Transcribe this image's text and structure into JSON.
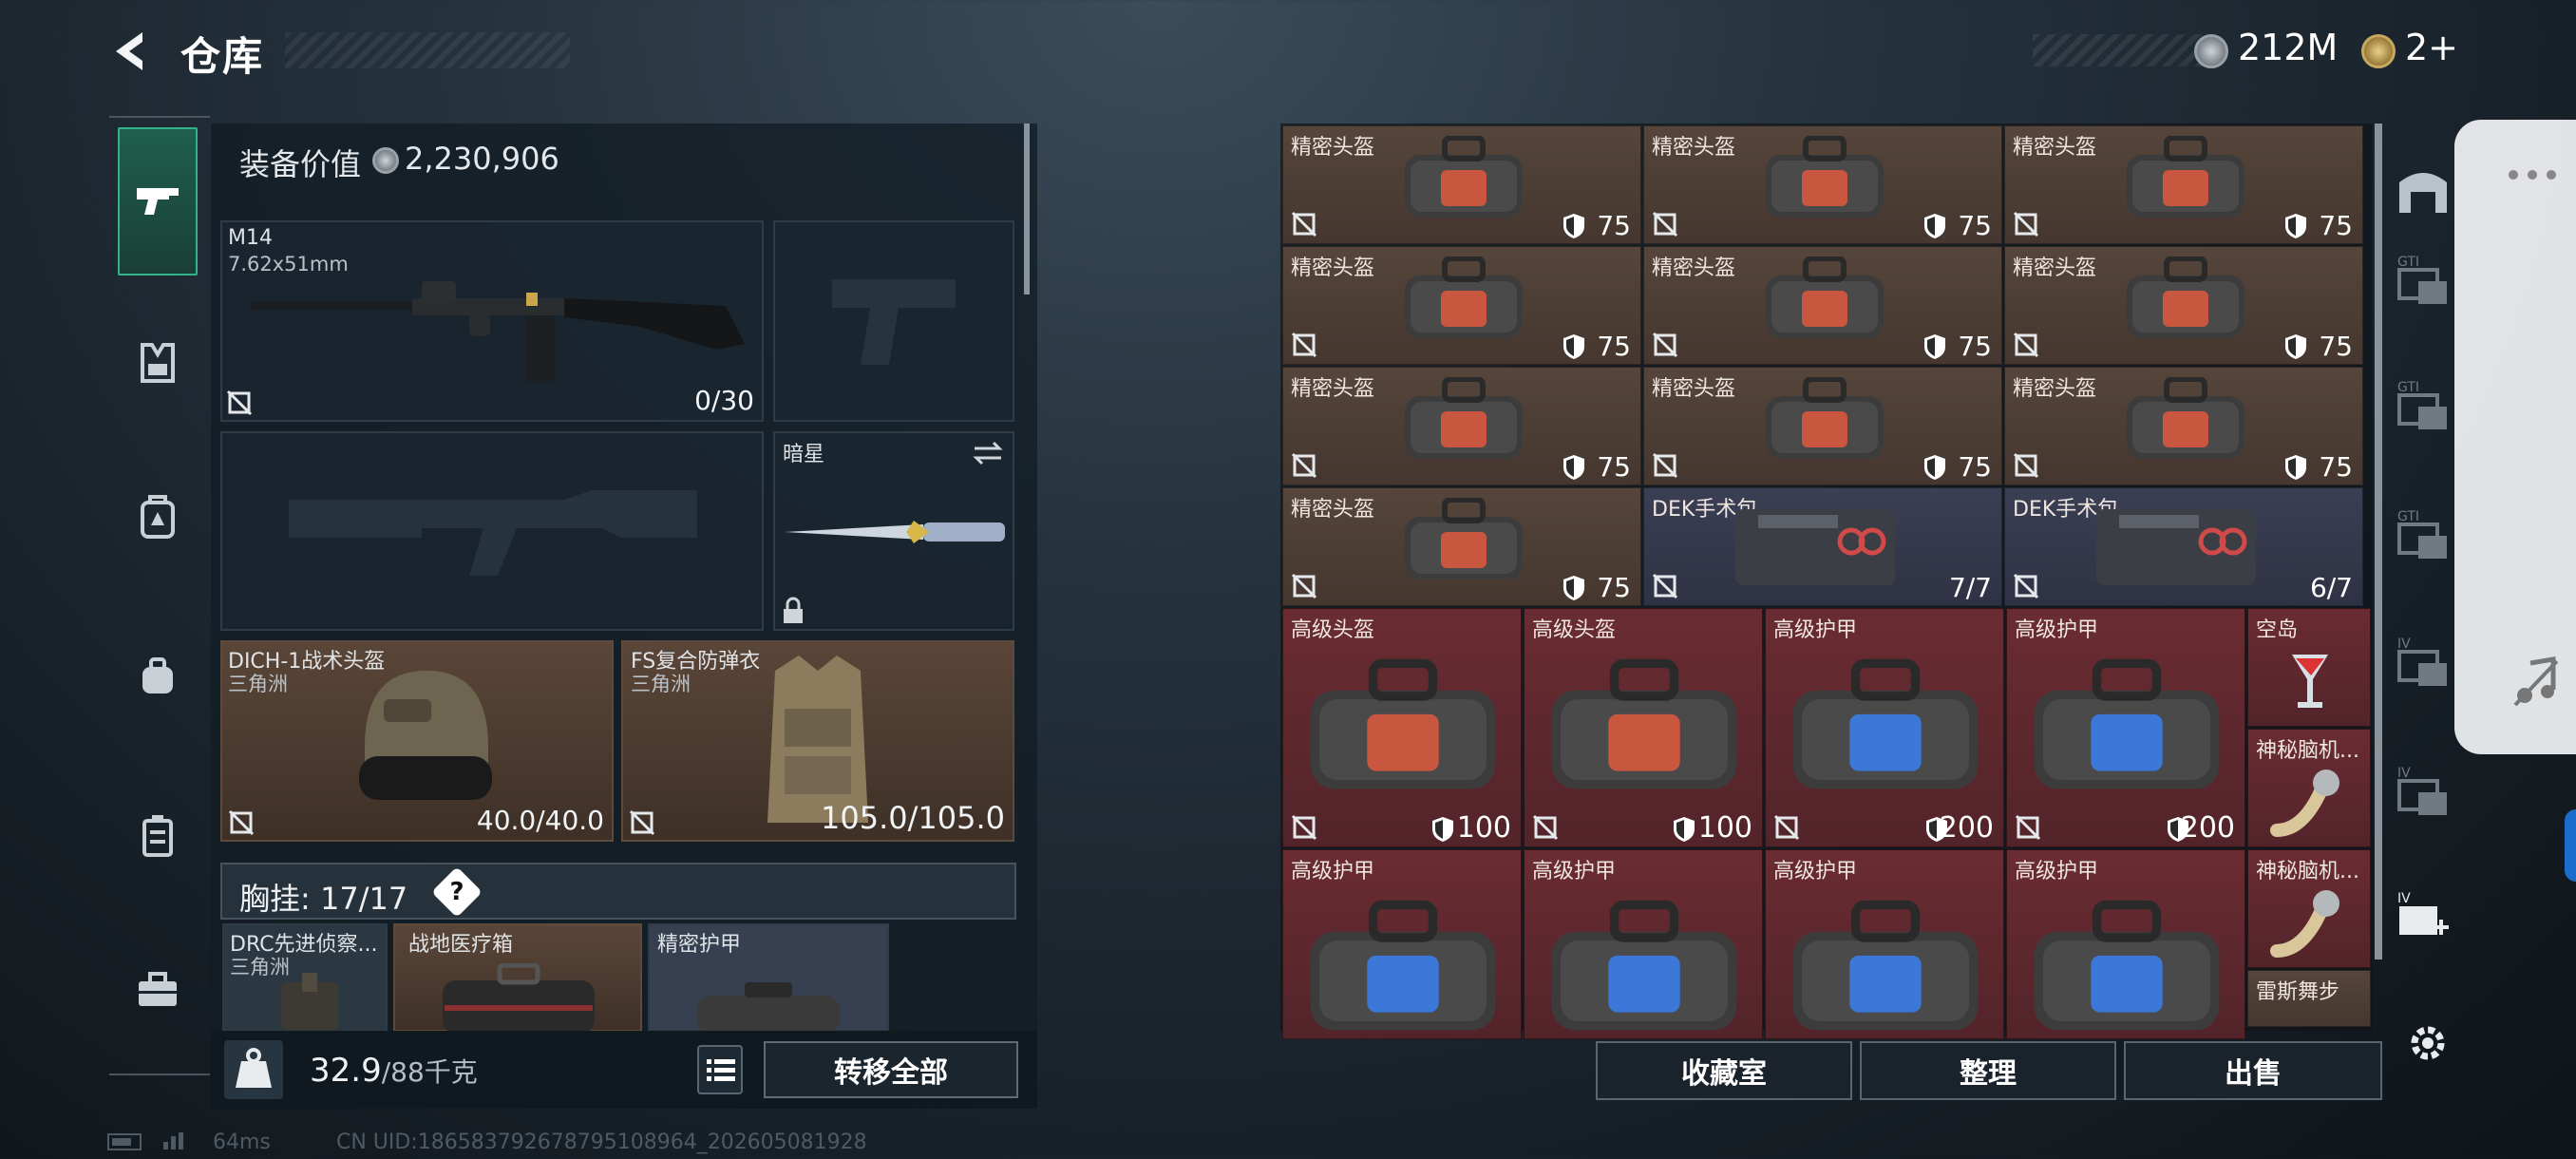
{
  "header": {
    "title": "仓库",
    "currency1": "212M",
    "currency2": "2+"
  },
  "equipment": {
    "value_label": "装备价值",
    "value": "2,230,906",
    "primary": {
      "name": "M14",
      "ammo_type": "7.62x51mm",
      "ammo": "0/30"
    },
    "melee": {
      "name": "暗星"
    },
    "helmet": {
      "name": "DICH-1战术头盔",
      "origin": "三角洲",
      "durability": "40.0/40.0"
    },
    "armor": {
      "name": "FS复合防弹衣",
      "origin": "三角洲",
      "durability": "105.0/105.0"
    },
    "chest": {
      "label": "胸挂:",
      "count": "17/17",
      "help": "?"
    },
    "chest_items": [
      {
        "name": "DRC先进侦察...",
        "origin": "三角洲"
      },
      {
        "name": "战地医疗箱"
      },
      {
        "name": "精密护甲"
      }
    ]
  },
  "bottom": {
    "weight": "32.9",
    "weight_max": "/88千克",
    "transfer_all": "转移全部"
  },
  "grid": {
    "rows": [
      [
        {
          "name": "精密头盔",
          "val": "75"
        },
        {
          "name": "精密头盔",
          "val": "75"
        },
        {
          "name": "精密头盔",
          "val": "75"
        }
      ],
      [
        {
          "name": "精密头盔",
          "val": "75"
        },
        {
          "name": "精密头盔",
          "val": "75"
        },
        {
          "name": "精密头盔",
          "val": "75"
        }
      ],
      [
        {
          "name": "精密头盔",
          "val": "75"
        },
        {
          "name": "精密头盔",
          "val": "75"
        },
        {
          "name": "精密头盔",
          "val": "75"
        }
      ],
      [
        {
          "name": "精密头盔",
          "val": "75"
        },
        {
          "name": "DEK手术包",
          "val": "7/7"
        },
        {
          "name": "DEK手术包",
          "val": "6/7"
        }
      ]
    ],
    "big_row1": [
      {
        "name": "高级头盔",
        "val": "100"
      },
      {
        "name": "高级头盔",
        "val": "100"
      },
      {
        "name": "高级护甲",
        "val": "200"
      },
      {
        "name": "高级护甲",
        "val": "200"
      }
    ],
    "big_row2": [
      {
        "name": "高级护甲"
      },
      {
        "name": "高级护甲"
      },
      {
        "name": "高级护甲"
      },
      {
        "name": "高级护甲"
      }
    ],
    "small_col": [
      {
        "name": "空岛"
      },
      {
        "name": "神秘脑机..."
      },
      {
        "name": "神秘脑机..."
      },
      {
        "name": "雷斯舞步"
      }
    ]
  },
  "grid_buttons": {
    "collection": "收藏室",
    "sort": "整理",
    "sell": "出售"
  },
  "footer": {
    "ping": "64ms",
    "uid": "CN UID:1865837926787951089​64_202605081928"
  },
  "colors": {
    "accent": "#34b28c",
    "brown_cell": "#4f4036",
    "red_cell": "#5e272d",
    "blue_cell": "#363a4e"
  }
}
